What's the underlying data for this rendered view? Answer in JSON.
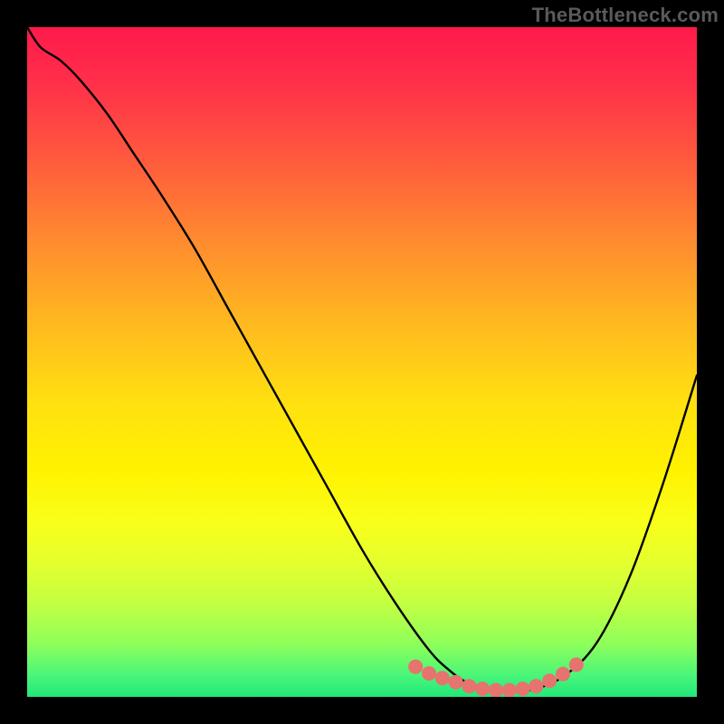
{
  "watermark": "TheBottleneck.com",
  "colors": {
    "frame": "#000000",
    "curve_stroke": "#000000",
    "marker_fill": "#e6736e",
    "gradient_top": "#ff1a4b",
    "gradient_bottom": "#22e77a"
  },
  "chart_data": {
    "type": "line",
    "title": "",
    "xlabel": "",
    "ylabel": "",
    "xlim": [
      0,
      100
    ],
    "ylim": [
      0,
      100
    ],
    "x": [
      0,
      2,
      5,
      8,
      12,
      16,
      20,
      25,
      30,
      35,
      40,
      45,
      50,
      55,
      60,
      63,
      66,
      70,
      75,
      80,
      85,
      90,
      95,
      100
    ],
    "values": [
      100,
      97,
      95,
      92,
      87,
      81,
      75,
      67,
      58,
      49,
      40,
      31,
      22,
      14,
      7,
      4,
      2,
      1,
      1,
      3,
      8,
      18,
      32,
      48
    ],
    "series": [
      {
        "name": "bottleneck-curve",
        "x": [
          0,
          2,
          5,
          8,
          12,
          16,
          20,
          25,
          30,
          35,
          40,
          45,
          50,
          55,
          60,
          63,
          66,
          70,
          75,
          80,
          85,
          90,
          95,
          100
        ],
        "values": [
          100,
          97,
          95,
          92,
          87,
          81,
          75,
          67,
          58,
          49,
          40,
          31,
          22,
          14,
          7,
          4,
          2,
          1,
          1,
          3,
          8,
          18,
          32,
          48
        ]
      }
    ],
    "markers": {
      "name": "highlighted-range",
      "x": [
        58,
        60,
        62,
        64,
        66,
        68,
        70,
        72,
        74,
        76,
        78,
        80,
        82
      ],
      "values": [
        4.5,
        3.5,
        2.8,
        2.2,
        1.6,
        1.2,
        1.0,
        1.0,
        1.2,
        1.6,
        2.4,
        3.4,
        4.8
      ]
    }
  }
}
